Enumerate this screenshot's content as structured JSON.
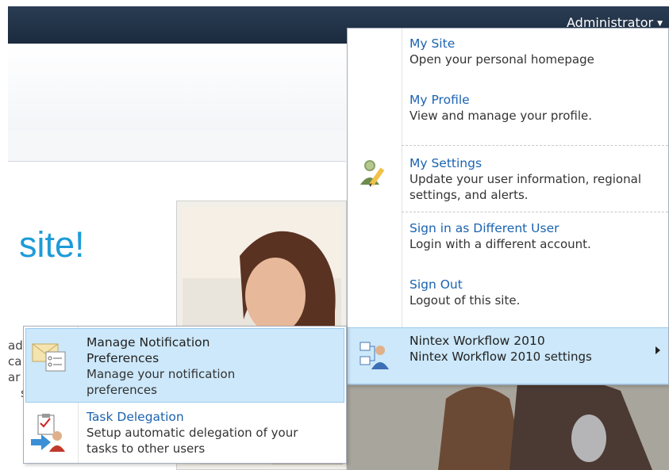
{
  "topbar": {
    "user_label": "Administrator"
  },
  "page": {
    "site_title_fragment": "site!",
    "body_text_fragments": [
      "ad",
      "ca",
      "ar",
      "s"
    ]
  },
  "user_menu": {
    "items": [
      {
        "title": "My Site",
        "desc": "Open your personal homepage"
      },
      {
        "title": "My Profile",
        "desc": "View and manage your profile."
      },
      {
        "title": "My Settings",
        "desc": "Update your user information, regional settings, and alerts.",
        "icon": "user-settings-pencil-icon"
      },
      {
        "title": "Sign in as Different User",
        "desc": "Login with a different account."
      },
      {
        "title": "Sign Out",
        "desc": "Logout of this site."
      },
      {
        "title": "Nintex Workflow 2010",
        "desc": "Nintex Workflow 2010 settings",
        "icon": "nintex-workflow-icon",
        "has_submenu": true
      }
    ]
  },
  "submenu": {
    "items": [
      {
        "title": "Manage Notification Preferences",
        "desc": "Manage your notification preferences",
        "icon": "notification-envelope-icon"
      },
      {
        "title": "Task Delegation",
        "desc": "Setup automatic delegation of your tasks to other users",
        "icon": "task-delegation-icon"
      }
    ]
  },
  "colors": {
    "topbar": "#1f2f44",
    "link": "#1b63b0",
    "site_title": "#1e9bd8",
    "highlight": "#cce8fa"
  }
}
